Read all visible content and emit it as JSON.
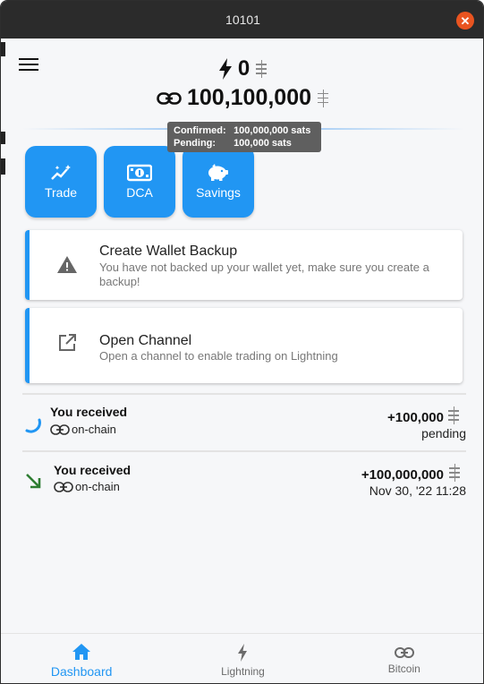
{
  "window": {
    "title": "10101"
  },
  "balance": {
    "lightning": "0",
    "onchain": "100,100,000"
  },
  "tooltip": {
    "confirmed_label": "Confirmed:",
    "confirmed_value": "100,000,000 sats",
    "pending_label": "Pending:",
    "pending_value": "100,000 sats"
  },
  "actions": [
    {
      "label": "Trade",
      "icon": "trade-sparkle-icon"
    },
    {
      "label": "DCA",
      "icon": "cash-icon"
    },
    {
      "label": "Savings",
      "icon": "piggy-bank-icon"
    }
  ],
  "cards": [
    {
      "title": "Create Wallet Backup",
      "subtitle": "You have not backed up your wallet yet, make sure you create a backup!",
      "icon": "warning-icon"
    },
    {
      "title": "Open Channel",
      "subtitle": "Open a channel to enable trading on Lightning",
      "icon": "open-external-icon"
    }
  ],
  "transactions": [
    {
      "title": "You received",
      "network": "on-chain",
      "amount": "+100,000",
      "status": "pending",
      "icon": "pending-spinner-icon"
    },
    {
      "title": "You received",
      "network": "on-chain",
      "amount": "+100,000,000",
      "status": "Nov 30, '22 11:28",
      "icon": "arrow-down-right-icon"
    }
  ],
  "nav": [
    {
      "label": "Dashboard",
      "icon": "home-icon",
      "active": true
    },
    {
      "label": "Lightning",
      "icon": "bolt-icon",
      "active": false
    },
    {
      "label": "Bitcoin",
      "icon": "link-icon",
      "active": false
    }
  ],
  "colors": {
    "accent": "#2196f3",
    "titlebar": "#2b2b2b",
    "close": "#e95420",
    "received_arrow": "#2e7d32"
  }
}
